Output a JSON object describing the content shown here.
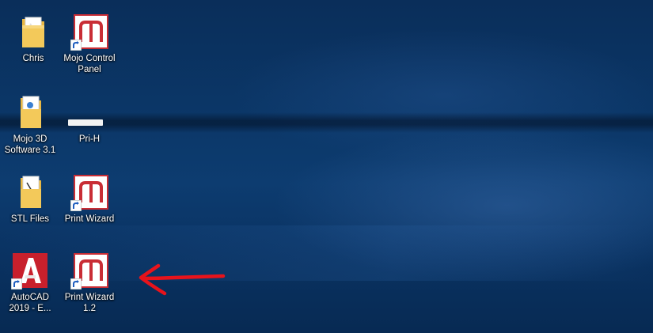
{
  "desktop": {
    "icons": [
      {
        "label": "Chris",
        "icon": "folder-icon"
      },
      {
        "label": "Mojo Control Panel",
        "icon": "mojo-logo-icon",
        "shortcut": true
      },
      {
        "label": "Mojo 3D Software 3.1",
        "icon": "folder-pdf-icon"
      },
      {
        "label": "Pri-H",
        "icon": "redacted-icon"
      },
      {
        "label": "STL Files",
        "icon": "folder-icon"
      },
      {
        "label": "Print Wizard",
        "icon": "mojo-logo-icon",
        "shortcut": true
      },
      {
        "label": "AutoCAD 2019 - E...",
        "icon": "autocad-icon",
        "shortcut": true
      },
      {
        "label": "Print Wizard 1.2",
        "icon": "mojo-logo-icon",
        "shortcut": true
      }
    ]
  },
  "annotation": {
    "arrow_color": "#e8131b",
    "target": "Print Wizard 1.2"
  },
  "colors": {
    "mojo_red": "#c92d35",
    "autocad_red": "#c8202c",
    "folder_yellow": "#f3c95a"
  }
}
